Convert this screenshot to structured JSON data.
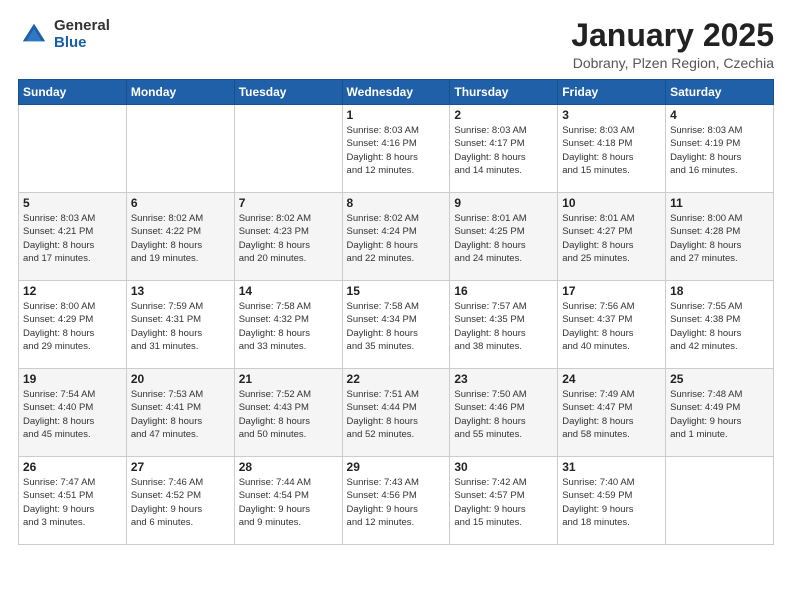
{
  "header": {
    "logo_general": "General",
    "logo_blue": "Blue",
    "title": "January 2025",
    "subtitle": "Dobrany, Plzen Region, Czechia"
  },
  "days_of_week": [
    "Sunday",
    "Monday",
    "Tuesday",
    "Wednesday",
    "Thursday",
    "Friday",
    "Saturday"
  ],
  "weeks": [
    [
      {
        "day": "",
        "info": ""
      },
      {
        "day": "",
        "info": ""
      },
      {
        "day": "",
        "info": ""
      },
      {
        "day": "1",
        "info": "Sunrise: 8:03 AM\nSunset: 4:16 PM\nDaylight: 8 hours\nand 12 minutes."
      },
      {
        "day": "2",
        "info": "Sunrise: 8:03 AM\nSunset: 4:17 PM\nDaylight: 8 hours\nand 14 minutes."
      },
      {
        "day": "3",
        "info": "Sunrise: 8:03 AM\nSunset: 4:18 PM\nDaylight: 8 hours\nand 15 minutes."
      },
      {
        "day": "4",
        "info": "Sunrise: 8:03 AM\nSunset: 4:19 PM\nDaylight: 8 hours\nand 16 minutes."
      }
    ],
    [
      {
        "day": "5",
        "info": "Sunrise: 8:03 AM\nSunset: 4:21 PM\nDaylight: 8 hours\nand 17 minutes."
      },
      {
        "day": "6",
        "info": "Sunrise: 8:02 AM\nSunset: 4:22 PM\nDaylight: 8 hours\nand 19 minutes."
      },
      {
        "day": "7",
        "info": "Sunrise: 8:02 AM\nSunset: 4:23 PM\nDaylight: 8 hours\nand 20 minutes."
      },
      {
        "day": "8",
        "info": "Sunrise: 8:02 AM\nSunset: 4:24 PM\nDaylight: 8 hours\nand 22 minutes."
      },
      {
        "day": "9",
        "info": "Sunrise: 8:01 AM\nSunset: 4:25 PM\nDaylight: 8 hours\nand 24 minutes."
      },
      {
        "day": "10",
        "info": "Sunrise: 8:01 AM\nSunset: 4:27 PM\nDaylight: 8 hours\nand 25 minutes."
      },
      {
        "day": "11",
        "info": "Sunrise: 8:00 AM\nSunset: 4:28 PM\nDaylight: 8 hours\nand 27 minutes."
      }
    ],
    [
      {
        "day": "12",
        "info": "Sunrise: 8:00 AM\nSunset: 4:29 PM\nDaylight: 8 hours\nand 29 minutes."
      },
      {
        "day": "13",
        "info": "Sunrise: 7:59 AM\nSunset: 4:31 PM\nDaylight: 8 hours\nand 31 minutes."
      },
      {
        "day": "14",
        "info": "Sunrise: 7:58 AM\nSunset: 4:32 PM\nDaylight: 8 hours\nand 33 minutes."
      },
      {
        "day": "15",
        "info": "Sunrise: 7:58 AM\nSunset: 4:34 PM\nDaylight: 8 hours\nand 35 minutes."
      },
      {
        "day": "16",
        "info": "Sunrise: 7:57 AM\nSunset: 4:35 PM\nDaylight: 8 hours\nand 38 minutes."
      },
      {
        "day": "17",
        "info": "Sunrise: 7:56 AM\nSunset: 4:37 PM\nDaylight: 8 hours\nand 40 minutes."
      },
      {
        "day": "18",
        "info": "Sunrise: 7:55 AM\nSunset: 4:38 PM\nDaylight: 8 hours\nand 42 minutes."
      }
    ],
    [
      {
        "day": "19",
        "info": "Sunrise: 7:54 AM\nSunset: 4:40 PM\nDaylight: 8 hours\nand 45 minutes."
      },
      {
        "day": "20",
        "info": "Sunrise: 7:53 AM\nSunset: 4:41 PM\nDaylight: 8 hours\nand 47 minutes."
      },
      {
        "day": "21",
        "info": "Sunrise: 7:52 AM\nSunset: 4:43 PM\nDaylight: 8 hours\nand 50 minutes."
      },
      {
        "day": "22",
        "info": "Sunrise: 7:51 AM\nSunset: 4:44 PM\nDaylight: 8 hours\nand 52 minutes."
      },
      {
        "day": "23",
        "info": "Sunrise: 7:50 AM\nSunset: 4:46 PM\nDaylight: 8 hours\nand 55 minutes."
      },
      {
        "day": "24",
        "info": "Sunrise: 7:49 AM\nSunset: 4:47 PM\nDaylight: 8 hours\nand 58 minutes."
      },
      {
        "day": "25",
        "info": "Sunrise: 7:48 AM\nSunset: 4:49 PM\nDaylight: 9 hours\nand 1 minute."
      }
    ],
    [
      {
        "day": "26",
        "info": "Sunrise: 7:47 AM\nSunset: 4:51 PM\nDaylight: 9 hours\nand 3 minutes."
      },
      {
        "day": "27",
        "info": "Sunrise: 7:46 AM\nSunset: 4:52 PM\nDaylight: 9 hours\nand 6 minutes."
      },
      {
        "day": "28",
        "info": "Sunrise: 7:44 AM\nSunset: 4:54 PM\nDaylight: 9 hours\nand 9 minutes."
      },
      {
        "day": "29",
        "info": "Sunrise: 7:43 AM\nSunset: 4:56 PM\nDaylight: 9 hours\nand 12 minutes."
      },
      {
        "day": "30",
        "info": "Sunrise: 7:42 AM\nSunset: 4:57 PM\nDaylight: 9 hours\nand 15 minutes."
      },
      {
        "day": "31",
        "info": "Sunrise: 7:40 AM\nSunset: 4:59 PM\nDaylight: 9 hours\nand 18 minutes."
      },
      {
        "day": "",
        "info": ""
      }
    ]
  ]
}
